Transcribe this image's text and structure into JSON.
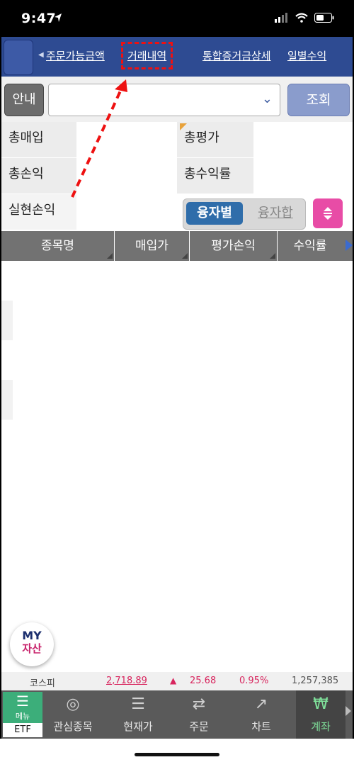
{
  "status_bar": {
    "time": "9:47"
  },
  "tabs": [
    "주문가능금액",
    "거래내역",
    "통합증거금상세",
    "일별수익"
  ],
  "selected_tab": 1,
  "input_row": {
    "info_label": "안내",
    "query_label": "조회"
  },
  "summary": {
    "labels": {
      "total_buy": "총매입",
      "total_eval": "총평가",
      "total_pl": "총손익",
      "total_return": "총수익률",
      "realized_pl": "실현손익"
    },
    "toggle_on": "융자별",
    "toggle_off": "융자합"
  },
  "table_headers": [
    "종목명",
    "매입가",
    "평가손익",
    "수익률"
  ],
  "my_button": {
    "line1": "MY",
    "line2": "자산"
  },
  "ticker": {
    "index_name": "코스피",
    "value": "2,718.89",
    "change": "25.68",
    "percent": "0.95%",
    "volume": "1,257,385",
    "color_up": "#d8255e"
  },
  "nav": {
    "menu_label": "메뉴",
    "etf_label": "ETF",
    "items": [
      "관심종목",
      "현재가",
      "주문",
      "차트",
      "계좌"
    ],
    "active_index": 4
  },
  "colors": {
    "tabbar": "#2e4b92",
    "annotation": "#e11111"
  }
}
